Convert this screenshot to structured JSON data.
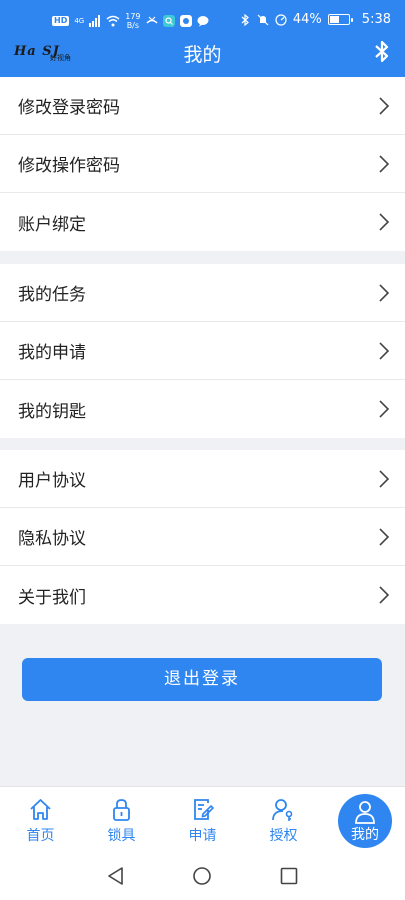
{
  "status_bar": {
    "hd": "HD",
    "network": "4G",
    "speed_value": "179",
    "speed_unit": "B/s",
    "battery": "44%",
    "battery_level": 0.44,
    "time": "5:38"
  },
  "header": {
    "logo_text": "Ha SJ",
    "logo_subtext": "好视角",
    "title": "我的"
  },
  "menu_groups": [
    [
      {
        "label": "修改登录密码"
      },
      {
        "label": "修改操作密码"
      },
      {
        "label": "账户绑定"
      }
    ],
    [
      {
        "label": "我的任务"
      },
      {
        "label": "我的申请"
      },
      {
        "label": "我的钥匙"
      }
    ],
    [
      {
        "label": "用户协议"
      },
      {
        "label": "隐私协议"
      },
      {
        "label": "关于我们"
      }
    ]
  ],
  "logout_label": "退出登录",
  "tabs": [
    {
      "label": "首页",
      "icon": "home-icon"
    },
    {
      "label": "锁具",
      "icon": "lock-icon"
    },
    {
      "label": "申请",
      "icon": "edit-document-icon"
    },
    {
      "label": "授权",
      "icon": "user-key-icon"
    },
    {
      "label": "我的",
      "icon": "user-icon",
      "active": true
    }
  ],
  "colors": {
    "primary": "#2f86f0",
    "background": "#f0f1f4",
    "text": "#222222"
  }
}
